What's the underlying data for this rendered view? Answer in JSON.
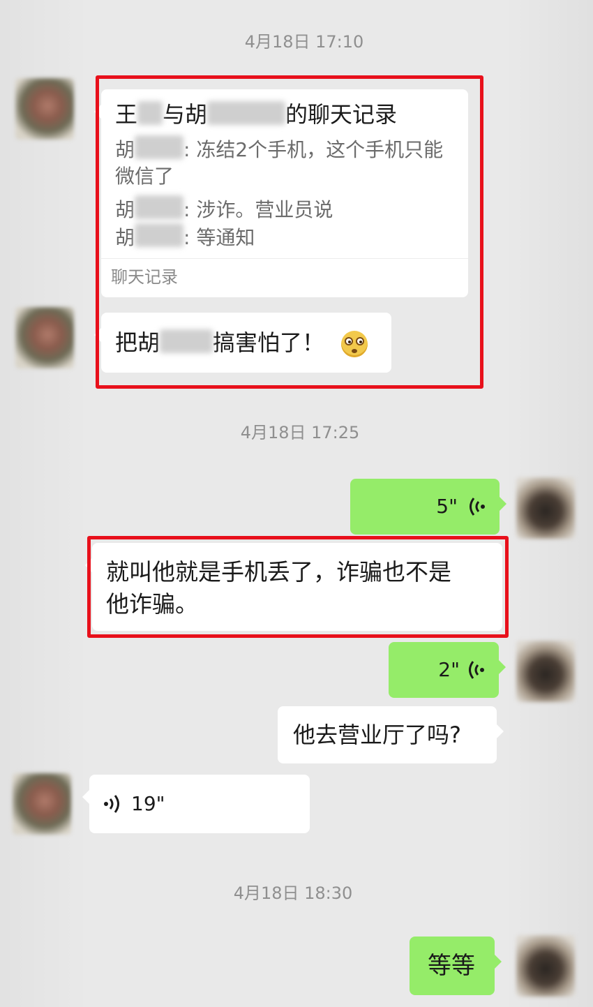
{
  "timestamps": [
    "4月18日 17:10",
    "4月18日 17:25",
    "4月18日 18:30"
  ],
  "chat_record_card": {
    "title_part1": "王",
    "title_part2": "与胡",
    "title_part3": "的聊天记录",
    "line1_prefix": "胡",
    "line1_text": ": 冻结2个手机，这个手机只能",
    "line1_cont": "微信了",
    "line2_prefix": "胡",
    "line2_text": ": 涉诈。营业员说",
    "line3_prefix": "胡",
    "line3_text": ": 等通知",
    "footer": "聊天记录"
  },
  "messages": {
    "scared_part1": "把胡",
    "scared_part2": "搞害怕了！",
    "voice_5": "5\"",
    "phone_lost_line1": "就叫他就是手机丢了，诈骗也不是",
    "phone_lost_line2": "他诈骗。",
    "voice_2": "2\"",
    "go_hall": "他去营业厅了吗?",
    "voice_19": "19\"",
    "wait": "等等"
  },
  "colors": {
    "highlight": "#e8101b",
    "sent_bubble": "#95ec69",
    "received_bubble": "#ffffff",
    "background": "#e9e9e9"
  },
  "icons": {
    "voice": "voice-wave-icon",
    "emoji": "shocked-face-emoji-icon"
  }
}
